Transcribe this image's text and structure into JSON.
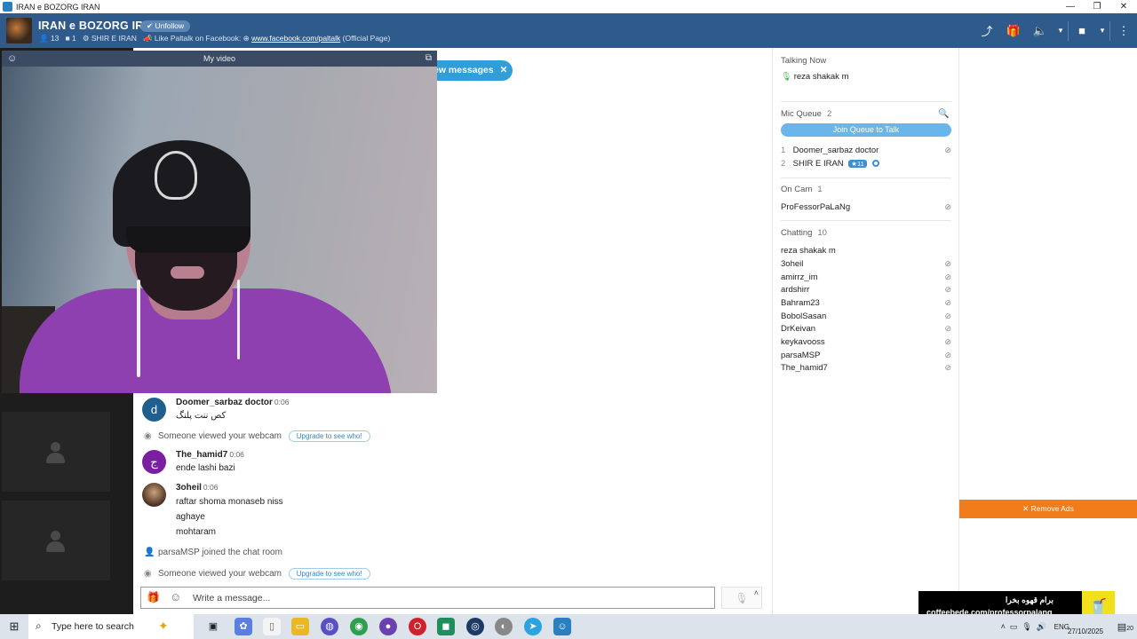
{
  "window": {
    "title": "IRAN e BOZORG IRAN",
    "controls": [
      "—",
      "❐",
      "✕"
    ]
  },
  "room": {
    "name": "IRAN e BOZORG IRAN",
    "follow_label": "Unfollow",
    "users_count": "13",
    "cams_count": "1",
    "owner": "SHIR E IRAN",
    "like_text": "Like Paltalk on Facebook:",
    "facebook_link": "www.facebook.com/paltalk",
    "facebook_suffix": "(Official Page)"
  },
  "video": {
    "title": "My video"
  },
  "new_messages": {
    "label": "ew messages"
  },
  "chat": {
    "messages": [
      {
        "initial": "d",
        "color": "#1f5f8f",
        "name": "Doomer_sarbaz doctor",
        "time": "0:06",
        "lines": [
          "کص ننت پلنگ"
        ]
      },
      {
        "initial": "ج",
        "color": "#7b1fa2",
        "name": "The_hamid7",
        "time": "0:06",
        "lines": [
          "ende lashi bazi"
        ]
      },
      {
        "initial": "",
        "color": "#5a3a2a",
        "name": "3oheil",
        "time": "0:06",
        "lines": [
          "raftar shoma monaseb niss",
          "aghaye",
          "mohtaram"
        ]
      }
    ],
    "system": [
      {
        "text": "Someone viewed your webcam",
        "button": "Upgrade to see who!"
      },
      {
        "text": "parsaMSP joined the chat room",
        "button": ""
      },
      {
        "text": "Someone viewed your webcam",
        "button": "Upgrade to see who!"
      }
    ],
    "composer_placeholder": "Write a message..."
  },
  "sidebar": {
    "talking_now": {
      "label": "Talking Now",
      "user": "reza shakak m"
    },
    "mic_queue": {
      "label": "Mic Queue",
      "count": "2",
      "join_label": "Join Queue to Talk",
      "users": [
        {
          "num": "1",
          "name": "Doomer_sarbaz doctor"
        },
        {
          "num": "2",
          "name": "SHIR E IRAN",
          "badge": "11"
        }
      ]
    },
    "on_cam": {
      "label": "On Cam",
      "count": "1",
      "users": [
        "ProFessorPaLaNg"
      ]
    },
    "chatting": {
      "label": "Chatting",
      "count": "10",
      "users": [
        "reza shakak m",
        "3oheil",
        "amirrz_im",
        "ardshirr",
        "Bahram23",
        "BobolSasan",
        "DrKeivan",
        "keykavooss",
        "parsaMSP",
        "The_hamid7"
      ]
    }
  },
  "ads": {
    "remove_label": "Remove Ads",
    "promo_farsi": "برام قهوه بخرا",
    "promo_url": "coffeebede.com/professorpalang"
  },
  "taskbar": {
    "search_placeholder": "Type here to search",
    "lang": "ENG",
    "date": "27/10/2025",
    "notification_count": "20"
  }
}
